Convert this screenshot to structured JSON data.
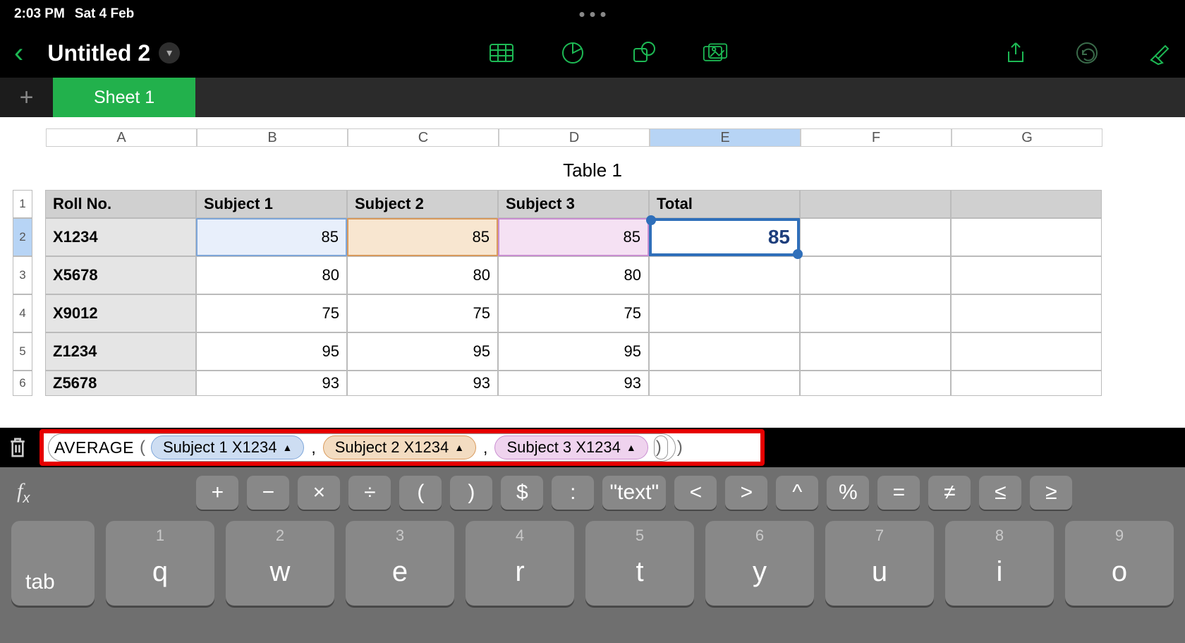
{
  "status": {
    "time": "2:03 PM",
    "date": "Sat 4 Feb"
  },
  "doc": {
    "title": "Untitled 2"
  },
  "tabs": {
    "sheet1": "Sheet 1"
  },
  "columns": [
    "A",
    "B",
    "C",
    "D",
    "E",
    "F",
    "G"
  ],
  "table_title": "Table 1",
  "headers": {
    "c0": "Roll No.",
    "c1": "Subject 1",
    "c2": "Subject 2",
    "c3": "Subject 3",
    "c4": "Total"
  },
  "rows": [
    {
      "n": "1"
    },
    {
      "n": "2",
      "roll": "X1234",
      "s1": "85",
      "s2": "85",
      "s3": "85",
      "total": "85"
    },
    {
      "n": "3",
      "roll": "X5678",
      "s1": "80",
      "s2": "80",
      "s3": "80"
    },
    {
      "n": "4",
      "roll": "X9012",
      "s1": "75",
      "s2": "75",
      "s3": "75"
    },
    {
      "n": "5",
      "roll": "Z1234",
      "s1": "95",
      "s2": "95",
      "s3": "95"
    },
    {
      "n": "6",
      "roll": "Z5678",
      "s1": "93",
      "s2": "93",
      "s3": "93"
    }
  ],
  "formula": {
    "fn": "AVERAGE",
    "ref1": "Subject 1 X1234",
    "ref2": "Subject 2 X1234",
    "ref3": "Subject 3 X1234",
    "triangle": "▲"
  },
  "ops": [
    "+",
    "−",
    "×",
    "÷",
    "(",
    ")",
    "$",
    ":",
    "\"text\"",
    "<",
    ">",
    "^",
    "%",
    "=",
    "≠",
    "≤",
    "≥"
  ],
  "kb": {
    "tab": "tab",
    "keys": [
      {
        "num": "1",
        "ch": "q"
      },
      {
        "num": "2",
        "ch": "w"
      },
      {
        "num": "3",
        "ch": "e"
      },
      {
        "num": "4",
        "ch": "r"
      },
      {
        "num": "5",
        "ch": "t"
      },
      {
        "num": "6",
        "ch": "y"
      },
      {
        "num": "7",
        "ch": "u"
      },
      {
        "num": "8",
        "ch": "i"
      },
      {
        "num": "9",
        "ch": "o"
      }
    ]
  }
}
